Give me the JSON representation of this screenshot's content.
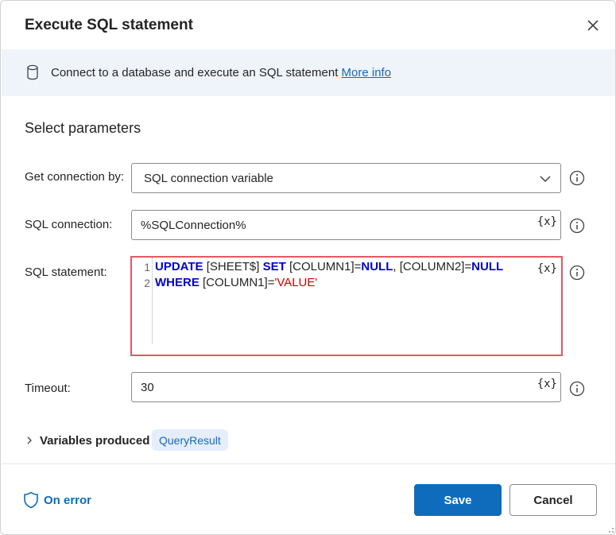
{
  "dialog": {
    "title": "Execute SQL statement",
    "close_icon": "close-icon"
  },
  "info": {
    "icon": "database-icon",
    "text": "Connect to a database and execute an SQL statement ",
    "link": "More info"
  },
  "section_title": "Select parameters",
  "params": {
    "get_connection_by": {
      "label": "Get connection by:",
      "value": "SQL connection variable"
    },
    "sql_connection": {
      "label": "SQL connection:",
      "value": "%SQLConnection%",
      "var_button": "{x}"
    },
    "sql_statement": {
      "label": "SQL statement:",
      "line_numbers": [
        "1",
        "2"
      ],
      "line1": {
        "kw_update": "UPDATE",
        "t1": " [SHEET$] ",
        "kw_set": "SET",
        "t2": " [COLUMN1]=",
        "kw_null1": "NULL",
        "t3": ", [COLUMN2]=",
        "kw_null2": "NULL"
      },
      "line2": {
        "kw_where": "WHERE",
        "t1": " [COLUMN1]=",
        "str_value": "'VALUE'"
      },
      "var_button": "{x}"
    },
    "timeout": {
      "label": "Timeout:",
      "value": "30",
      "var_button": "{x}"
    }
  },
  "variables_produced": {
    "label": "Variables produced",
    "variable": "QueryResult"
  },
  "footer": {
    "on_error": "On error",
    "save": "Save",
    "cancel": "Cancel"
  },
  "colors": {
    "accent": "#0f6cbd",
    "highlight_border": "#e05a63",
    "keyword": "#0000cc",
    "string": "#d00000",
    "banner_bg": "#eff4fb"
  }
}
